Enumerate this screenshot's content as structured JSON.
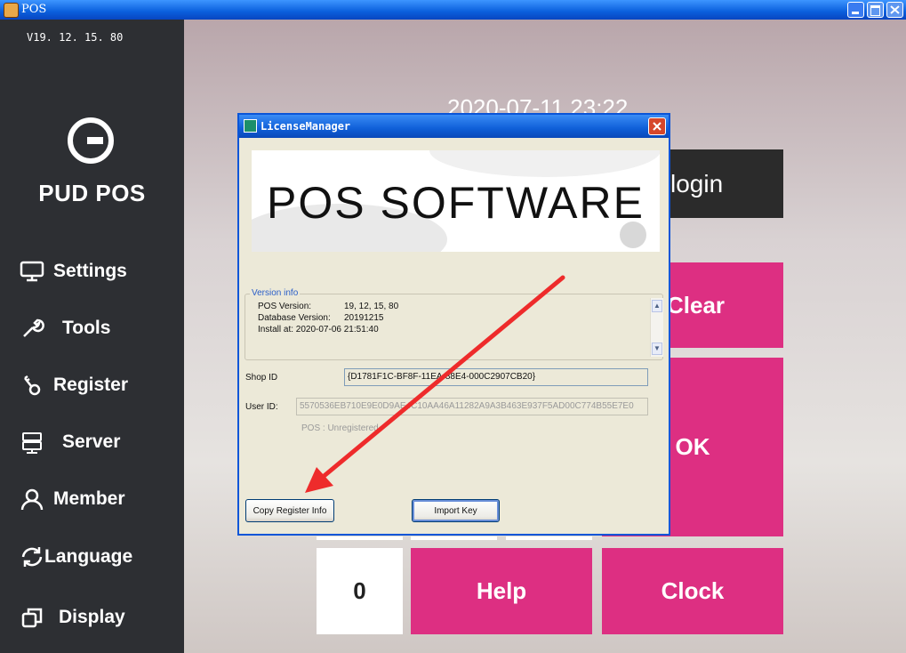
{
  "window": {
    "title": "POS"
  },
  "sidebar": {
    "version": "V19. 12. 15. 80",
    "brand": "PUD POS",
    "items": [
      {
        "label": "Settings",
        "icon": "monitor-icon"
      },
      {
        "label": "Tools",
        "icon": "wrench-icon"
      },
      {
        "label": "Register",
        "icon": "key-icon"
      },
      {
        "label": "Server",
        "icon": "server-icon"
      },
      {
        "label": "Member",
        "icon": "user-icon"
      },
      {
        "label": "Language",
        "icon": "refresh-icon"
      },
      {
        "label": "Display",
        "icon": "windows-icon"
      }
    ]
  },
  "main": {
    "datetime": "2020-07-11 23:22",
    "login": "login",
    "clear": "Clear",
    "ok": "OK",
    "zero": "0",
    "help": "Help",
    "clock": "Clock"
  },
  "dialog": {
    "title": "LicenseManager",
    "banner": "POS SOFTWARE",
    "version_group": "Version info",
    "pos_version_label": "POS Version:",
    "pos_version": "19, 12, 15, 80",
    "db_version_label": "Database Version:",
    "db_version": "20191215",
    "install_at": "Install at: 2020-07-06 21:51:40",
    "shop_id_label": "Shop ID",
    "shop_id": "{D1781F1C-BF8F-11EA-88E4-000C2907CB20}",
    "user_id_label": "User ID:",
    "user_id": "5570536EB710E9E0D9AE4C10AA46A11282A9A3B463E937F5AD00C774B55E7E0",
    "status": "POS : Unregistered",
    "copy_button": "Copy Register Info",
    "import_button": "Import Key"
  },
  "colors": {
    "accent_pink": "#dd2f82",
    "sidebar_bg": "#2d2f33",
    "titlebar_blue": "#0a5fdc"
  }
}
